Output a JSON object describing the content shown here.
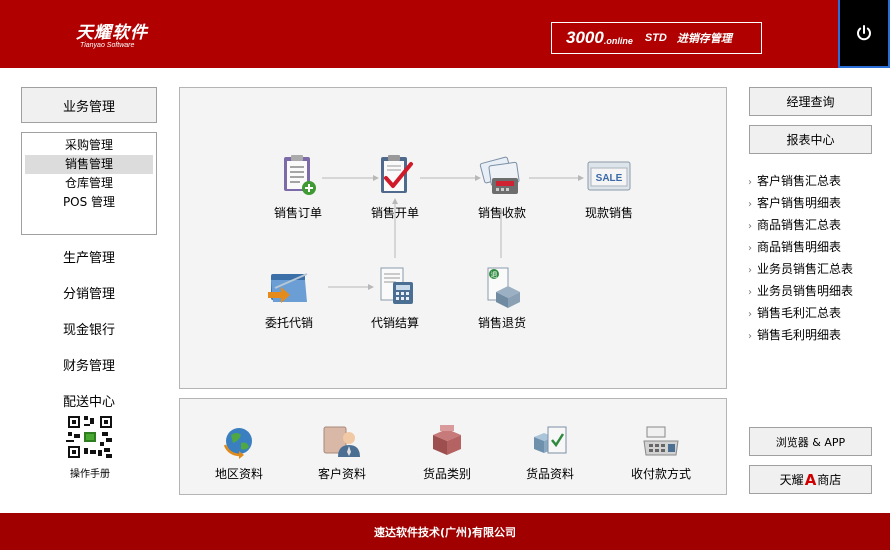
{
  "header": {
    "logo_main": "天耀软件",
    "logo_sub": "Tianyao Software",
    "product_version": "3000",
    "product_online": ".online",
    "product_edition": "STD",
    "product_title": "进销存管理",
    "power_icon": "power-icon",
    "colors": {
      "header_bg": "#b00000",
      "footer_bg": "#a10000",
      "power_bg": "#000000"
    }
  },
  "left_nav": {
    "business_label": "业务管理",
    "submenu": [
      {
        "label": "采购管理",
        "active": false
      },
      {
        "label": "销售管理",
        "active": true
      },
      {
        "label": "仓库管理",
        "active": false
      },
      {
        "label": "POS 管理",
        "active": false
      }
    ],
    "modules": [
      "生产管理",
      "分销管理",
      "现金银行",
      "财务管理",
      "配送中心"
    ],
    "manual_label": "操作手册",
    "qr_icon": "qr-code-icon"
  },
  "flow": {
    "nodes": [
      {
        "label": "销售订单",
        "icon": "clipboard-add-icon"
      },
      {
        "label": "销售开单",
        "icon": "clipboard-check-icon"
      },
      {
        "label": "销售收款",
        "icon": "card-payment-icon"
      },
      {
        "label": "现款销售",
        "icon": "sale-sign-icon"
      },
      {
        "label": "委托代销",
        "icon": "folder-arrow-icon"
      },
      {
        "label": "代销结算",
        "icon": "calculator-document-icon"
      },
      {
        "label": "销售退货",
        "icon": "return-goods-icon"
      }
    ]
  },
  "basic_data": {
    "items": [
      {
        "label": "地区资料",
        "icon": "globe-icon"
      },
      {
        "label": "客户资料",
        "icon": "customer-icon"
      },
      {
        "label": "货品类别",
        "icon": "goods-category-icon"
      },
      {
        "label": "货品资料",
        "icon": "goods-info-icon"
      },
      {
        "label": "收付款方式",
        "icon": "cash-register-icon"
      }
    ]
  },
  "right_nav": {
    "manager_query": "经理查询",
    "report_center": "报表中心",
    "reports": [
      "客户销售汇总表",
      "客户销售明细表",
      "商品销售汇总表",
      "商品销售明细表",
      "业务员销售汇总表",
      "业务员销售明细表",
      "销售毛利汇总表",
      "销售毛利明细表"
    ],
    "browser_app": "浏览器 & APP",
    "store_prefix": "天耀",
    "store_a": "A",
    "store_suffix": "商店"
  },
  "footer": {
    "company": "速达软件技术(广州)有限公司"
  }
}
